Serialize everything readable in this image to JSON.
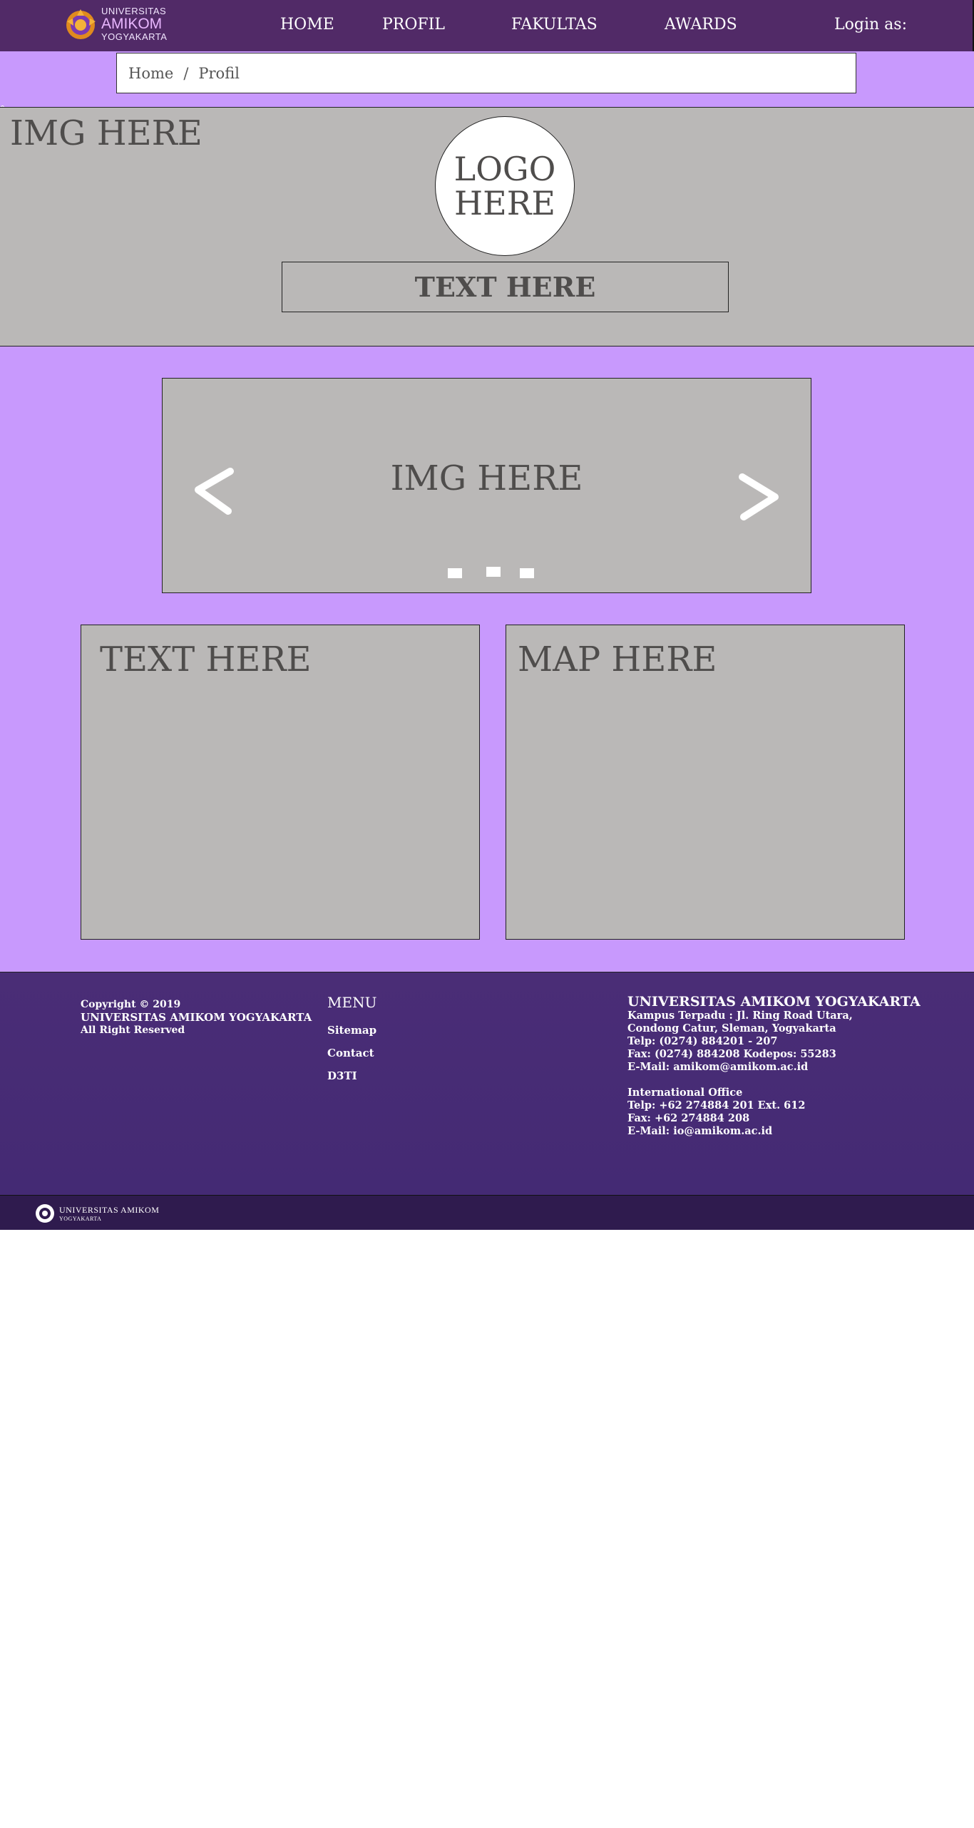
{
  "nav": {
    "logo": {
      "line1": "UNIVERSITAS",
      "line2": "AMIKOM",
      "line3": "YOGYAKARTA"
    },
    "links": [
      "HOME",
      "PROFIL",
      "FAKULTAS",
      "AWARDS"
    ],
    "login": "Login as:"
  },
  "breadcrumb": {
    "home": "Home",
    "separator": "/",
    "current": "Profil"
  },
  "hero": {
    "image_placeholder": "IMG HERE",
    "logo_line1": "LOGO",
    "logo_line2": "HERE",
    "text": "TEXT HERE"
  },
  "carousel": {
    "image_placeholder": "IMG HERE",
    "prev_icon": "chevron-left-icon",
    "next_icon": "chevron-right-icon",
    "indicators": 3
  },
  "content": {
    "text_placeholder": "TEXT HERE",
    "map_placeholder": "MAP HERE"
  },
  "footer": {
    "copyright": "Copyright © 2019",
    "org": "UNIVERSITAS AMIKOM YOGYAKARTA",
    "rights": "All Right Reserved",
    "menu_title": "MENU",
    "menu": [
      "Sitemap",
      "Contact",
      "D3TI"
    ],
    "contact_title": "UNIVERSITAS AMIKOM YOGYAKARTA",
    "address1": "Kampus Terpadu : Jl. Ring Road Utara,",
    "address2": "Condong Catur, Sleman, Yogyakarta",
    "telp": "Telp: (0274) 884201 - 207",
    "fax": "Fax: (0274) 884208 Kodepos: 55283",
    "email": "E-Mail: amikom@amikom.ac.id",
    "intl_title": "International Office",
    "intl_telp": "Telp: +62 274884 201 Ext. 612",
    "intl_fax": "Fax: +62 274884 208",
    "intl_email": "E-Mail: io@amikom.ac.id"
  },
  "bottom_bar": {
    "logo_line1": "UNIVERSITAS AMIKOM",
    "logo_line2": "YOGYAKARTA"
  },
  "colors": {
    "nav": "#512a67",
    "accent": "#c899fd",
    "placeholder": "#bab8b7",
    "footer": "#4a2d76",
    "bottom_bar": "#2f1b4e"
  }
}
